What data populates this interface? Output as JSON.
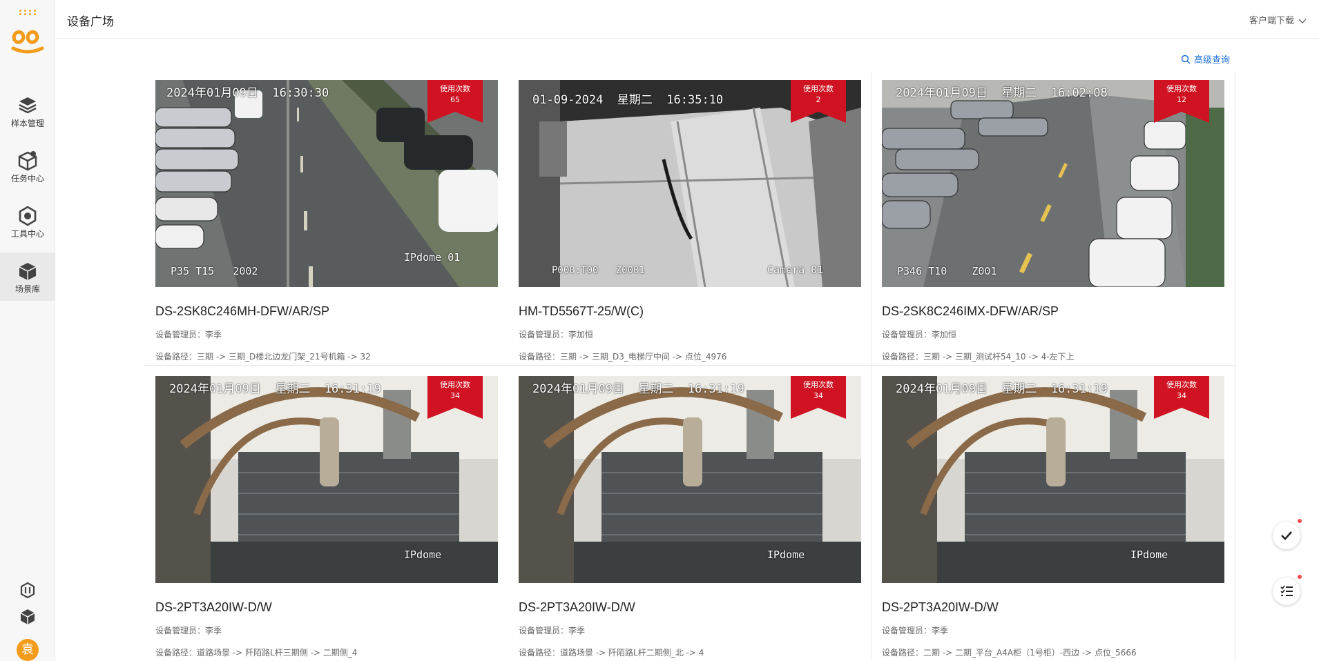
{
  "app": {
    "page_title": "设备广场",
    "client_download": "客户端下载",
    "advanced_search": "高级查询"
  },
  "sidebar": {
    "items": [
      {
        "label": "样本管理",
        "icon": "layers-icon"
      },
      {
        "label": "任务中心",
        "icon": "box-icon"
      },
      {
        "label": "工具中心",
        "icon": "hexagon-tool-icon"
      },
      {
        "label": "场景库",
        "icon": "scene-box-icon"
      }
    ],
    "active_index": 3,
    "user_avatar": "袁"
  },
  "cards": [
    {
      "title": "DS-2SK8C246MH-DFW/AR/SP",
      "manager": "设备管理员：李季",
      "path": "设备路径：三期 -> 三期_D楼北边龙门架_21号机箱 -> 32",
      "usage_label": "使用次数",
      "usage_count": "65",
      "osd_top": "2024年01月09日  16:30:30",
      "osd_bl": "P35 T15   2002",
      "osd_br": "IPdome 01"
    },
    {
      "title": "HM-TD5567T-25/W(C)",
      "manager": "设备管理员：李加恒",
      "path": "设备路径：三期 -> 三期_D3_电梯厅中间 -> 点位_4976",
      "usage_label": "使用次数",
      "usage_count": "2",
      "osd_top": "01-09-2024  星期二  16:35:10",
      "osd_bl": "P000:T00   Z0001",
      "osd_br": "Camera 01"
    },
    {
      "title": "DS-2SK8C246IMX-DFW/AR/SP",
      "manager": "设备管理员：李加恒",
      "path": "设备路径：三期 -> 三期_测试杆54_10 -> 4-左下上",
      "usage_label": "使用次数",
      "usage_count": "12",
      "osd_top": "2024年01月09日  星期二  16:02:08",
      "osd_bl": "P346 T10    Z001",
      "osd_br": ""
    },
    {
      "title": "DS-2PT3A20IW-D/W",
      "manager": "设备管理员：李季",
      "path": "设备路径：道路场景 -> 阡陌路L杆三期侧 -> 二期侧_4",
      "usage_label": "使用次数",
      "usage_count": "34",
      "osd_top": "2024年01月09日  星期二  16:31:19",
      "osd_bl": "",
      "osd_br": "IPdome"
    },
    {
      "title": "DS-2PT3A20IW-D/W",
      "manager": "设备管理员：李季",
      "path": "设备路径：道路场景 -> 阡陌路L杆二期侧_北 -> 4",
      "usage_label": "使用次数",
      "usage_count": "34",
      "osd_top": "2024年01月09日  星期二  16:31:19",
      "osd_bl": "",
      "osd_br": "IPdome"
    },
    {
      "title": "DS-2PT3A20IW-D/W",
      "manager": "设备管理员：李季",
      "path": "设备路径：二期 -> 二期_平台_A4A柜（1号柜）-西边 -> 点位_5666",
      "usage_label": "使用次数",
      "usage_count": "34",
      "osd_top": "2024年01月09日  星期二  16:31:19",
      "osd_bl": "",
      "osd_br": "IPdome"
    }
  ],
  "colors": {
    "ribbon": "#cf1322",
    "link": "#1e6fd9",
    "brand": "#f39b1a"
  }
}
